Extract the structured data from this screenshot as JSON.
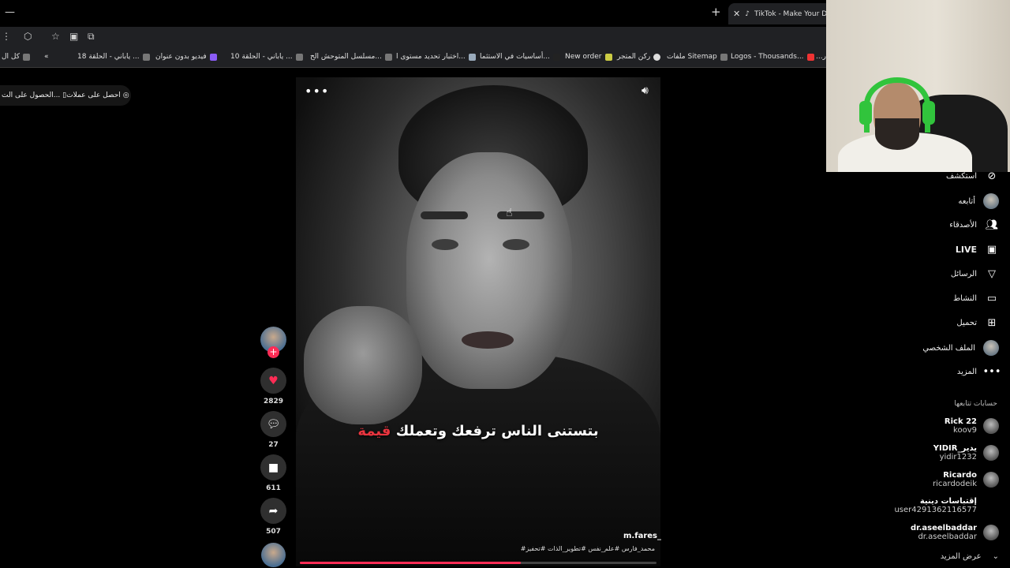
{
  "browser": {
    "tab_title": "TikTok - Make Your Day",
    "new_tab_symbol": "+",
    "close_symbol": "✕",
    "minimize_symbol": "—"
  },
  "bookmarks": [
    "كل ال",
    "ياباني - الحلقة 18 ...",
    "فيديو بدون عنوان",
    "ياباني - الحلقة 10 ...",
    "مسلسل المتوحش الح...",
    "اختبار تحديد مستوى ا...",
    "أساسيات في الاستثما...",
    "New order",
    "ركن المتجر",
    "ملفات Sitemap",
    "Logos - Thousands...",
    "...ر"
  ],
  "promo": {
    "coins": "احصل على عملات",
    "app": "الحصول على الت..."
  },
  "video": {
    "more_symbol": "•••",
    "caption_main": "بتستنى الناس ترفعك وتعملك",
    "caption_highlight": "قيمة",
    "username": "m.fares_",
    "hashtags": "#محمد_فارس #علم_نفس #تطوير_الذات #تحفيز",
    "progress": 0.62
  },
  "actions": {
    "likes": "2829",
    "comments": "27",
    "saves": "611",
    "shares": "507"
  },
  "sidebar": {
    "nav": [
      {
        "label": "استكشف",
        "icon": "compass-icon"
      },
      {
        "label": "أتابعه",
        "icon": "avatar"
      },
      {
        "label": "الأصدقاء",
        "icon": "friends-icon"
      },
      {
        "label": "LIVE",
        "icon": "live-icon"
      },
      {
        "label": "الرسائل",
        "icon": "messages-icon"
      },
      {
        "label": "النشاط",
        "icon": "activity-icon"
      },
      {
        "label": "تحميل",
        "icon": "upload-icon"
      },
      {
        "label": "الملف الشخصي",
        "icon": "profile-avatar"
      },
      {
        "label": "المزيد",
        "icon": "more-icon"
      }
    ],
    "following_title": "حسابات تتابعها",
    "accounts": [
      {
        "name": "Rick 22",
        "handle": "koov9"
      },
      {
        "name": "YIDIR_يدير",
        "handle": "yidir1232"
      },
      {
        "name": "Ricardo",
        "handle": "ricardodeik"
      },
      {
        "name": "إقتباسات دينية",
        "handle": "user4291362116577"
      },
      {
        "name": "dr.aseelbaddar",
        "handle": "dr.aseelbaddar"
      }
    ],
    "see_more": "عرض المزيد"
  }
}
